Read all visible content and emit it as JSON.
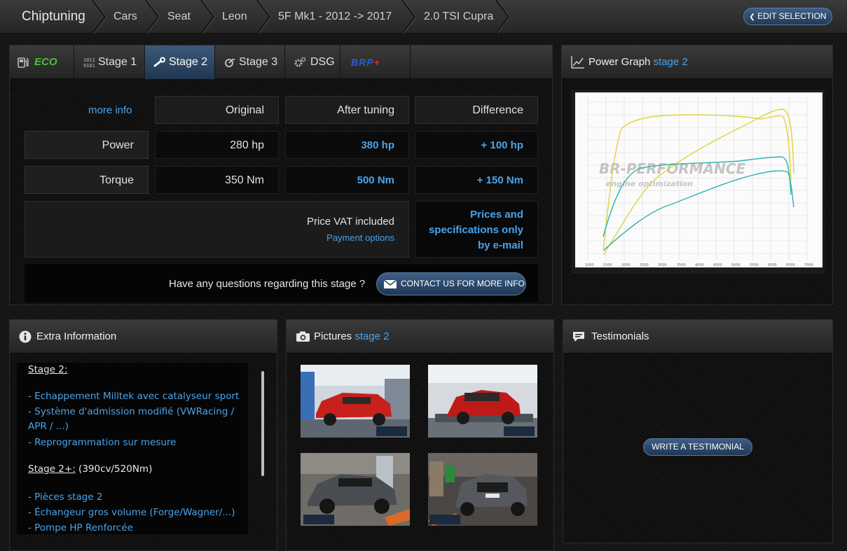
{
  "breadcrumb": {
    "items": [
      "Chiptuning",
      "Cars",
      "Seat",
      "Leon",
      "5F Mk1 - 2012 -> 2017",
      "2.0 TSI Cupra"
    ],
    "edit_selection": "EDIT SELECTION"
  },
  "tabs": [
    {
      "label": "ECO",
      "icon": "fuel-pump-icon"
    },
    {
      "label": "Stage 1",
      "icon": "binary-icon"
    },
    {
      "label": "Stage 2",
      "icon": "wrench-icon",
      "active": true
    },
    {
      "label": "Stage 3",
      "icon": "turbo-icon"
    },
    {
      "label": "DSG",
      "icon": "gear-icon"
    },
    {
      "label": "BRP+",
      "icon": "brp-logo"
    }
  ],
  "stats": {
    "more_info": "more info",
    "headers": [
      "Original",
      "After tuning",
      "Difference"
    ],
    "rows": [
      {
        "label": "Power",
        "original": "280 hp",
        "after": "380 hp",
        "diff": "+ 100 hp"
      },
      {
        "label": "Torque",
        "original": "350 Nm",
        "after": "500 Nm",
        "diff": "+ 150 Nm"
      }
    ],
    "price_label": "Price VAT included",
    "payment_options": "Payment options",
    "price_value": [
      "Prices and",
      "specifications only",
      "by e-mail"
    ],
    "question": "Have any questions regarding this stage ?",
    "contact_button": "CONTACT US FOR MORE INFO"
  },
  "power_graph": {
    "title": "Power Graph",
    "stage": "stage 2",
    "watermark": [
      "BR-PERFORMANCE",
      "engine optimization"
    ]
  },
  "extra_info": {
    "title": "Extra Information",
    "lines": [
      {
        "text": "Stage 2:",
        "style": "h"
      },
      {
        "text": "- Echappement Milltek avec catalyseur sport",
        "style": "i"
      },
      {
        "text": "- Système d'admission modifié (VWRacing /",
        "style": "i"
      },
      {
        "text": "APR / ...)",
        "style": "i"
      },
      {
        "text": "- Reprogrammation sur mesure",
        "style": "i"
      },
      {
        "text": "Stage 2+:",
        "suffix": " (390cv/520Nm)",
        "style": "h"
      },
      {
        "text": "- Pièces stage 2",
        "style": "i"
      },
      {
        "text": "- Échangeur gros volume (Forge/Wagner/...)",
        "style": "i"
      },
      {
        "text": "- Pompe HP Renforcée",
        "style": "i"
      }
    ]
  },
  "pictures": {
    "title": "Pictures",
    "stage": "stage 2",
    "items": [
      {
        "name": "red-leon-dyno-front-photo",
        "car": "#c8201d",
        "bg": "#cfd6de"
      },
      {
        "name": "red-leon-dyno-rear-photo",
        "car": "#c01a18",
        "bg": "#d6dadf"
      },
      {
        "name": "grey-leon-dyno-front-photo",
        "car": "#4a4d52",
        "bg": "#6f6c68"
      },
      {
        "name": "grey-leon-dyno-rear-photo",
        "car": "#55585c",
        "bg": "#4a4744"
      }
    ]
  },
  "testimonials": {
    "title": "Testimonials",
    "button": "WRITE A TESTIMONIAL"
  }
}
